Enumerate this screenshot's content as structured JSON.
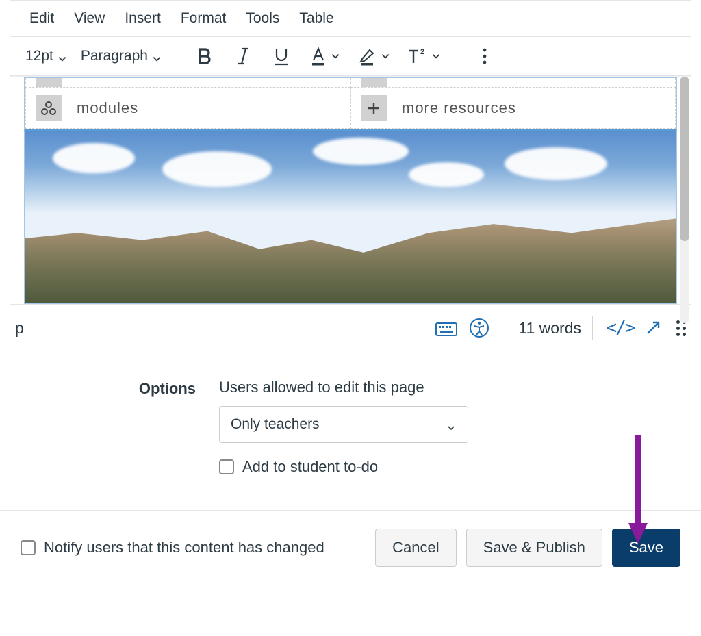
{
  "menubar": {
    "edit": "Edit",
    "view": "View",
    "insert": "Insert",
    "format": "Format",
    "tools": "Tools",
    "table": "Table"
  },
  "toolbar": {
    "font_size": "12pt",
    "block_format": "Paragraph"
  },
  "content": {
    "cells": {
      "modules": "modules",
      "more_resources": "more resources"
    }
  },
  "statusbar": {
    "path": "p",
    "word_count": "11 words"
  },
  "options": {
    "label": "Options",
    "edit_label": "Users allowed to edit this page",
    "select_value": "Only teachers",
    "todo_label": "Add to student to-do"
  },
  "footer": {
    "notify_label": "Notify users that this content has changed",
    "cancel": "Cancel",
    "save_publish": "Save & Publish",
    "save": "Save"
  }
}
